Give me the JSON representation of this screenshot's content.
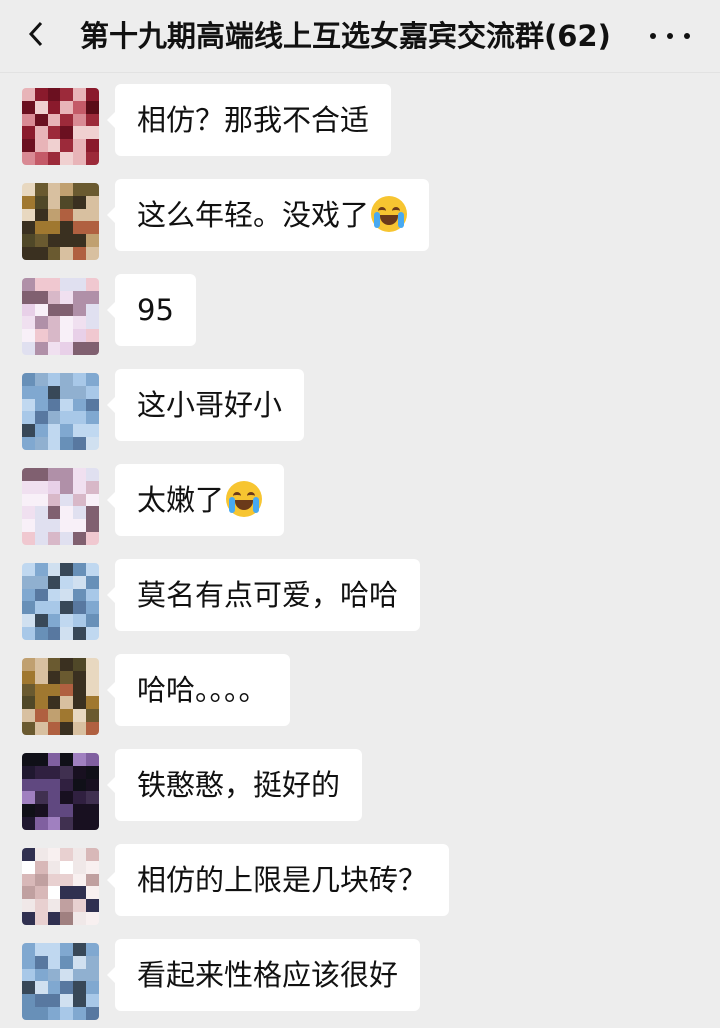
{
  "header": {
    "title": "第十九期高端线上互选女嘉宾交流群(62)",
    "back_icon": "chevron-left-icon",
    "more_icon": "more-dots-icon"
  },
  "messages": [
    {
      "text": "相仿？那我不合适",
      "emoji": ""
    },
    {
      "text": "这么年轻。没戏了",
      "emoji": "loudly-crying-face"
    },
    {
      "text": "95",
      "emoji": ""
    },
    {
      "text": "这小哥好小",
      "emoji": ""
    },
    {
      "text": "太嫩了",
      "emoji": "tears-of-joy-face"
    },
    {
      "text": "莫名有点可爱，哈哈",
      "emoji": ""
    },
    {
      "text": "哈哈。。。。",
      "emoji": ""
    },
    {
      "text": "铁憨憨，挺好的",
      "emoji": ""
    },
    {
      "text": "相仿的上限是几块砖？",
      "emoji": ""
    },
    {
      "text": "看起来性格应该很好",
      "emoji": ""
    }
  ],
  "colors": {
    "background": "#ededed",
    "bubble": "#ffffff",
    "text": "#111111"
  }
}
